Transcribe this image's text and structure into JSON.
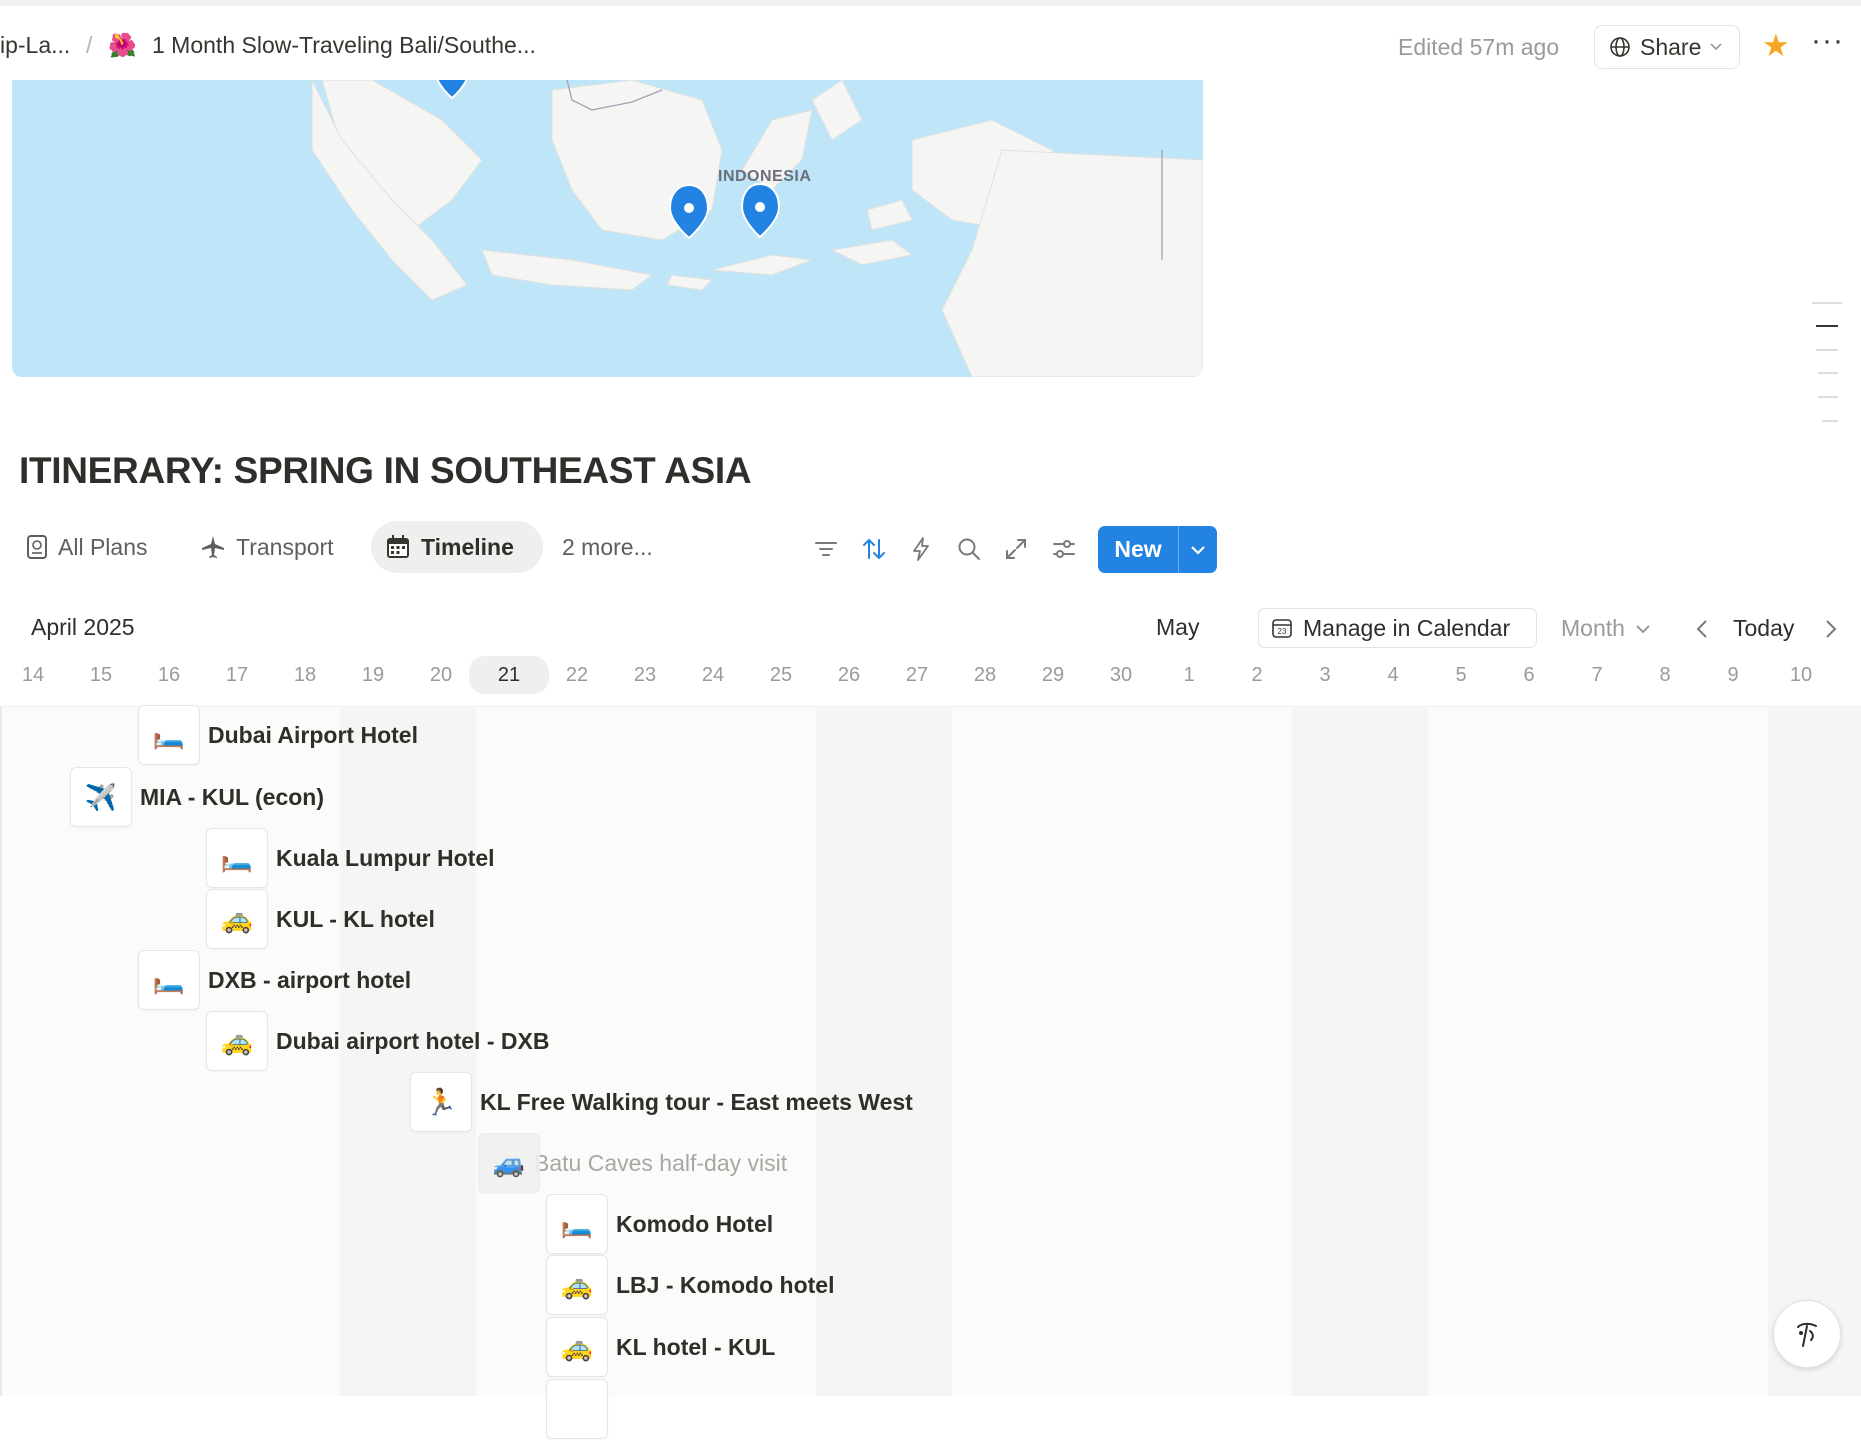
{
  "topbar": {
    "breadcrumb_parent": "ip-La...",
    "breadcrumb_separator": "/",
    "page_emoji": "🌺",
    "page_title": "1 Month Slow-Traveling Bali/Southe...",
    "edited": "Edited 57m ago",
    "share_label": "Share",
    "more_label": "···"
  },
  "map": {
    "country_label": "INDONESIA",
    "pin_color": "#2383e2",
    "water_color": "#bfe6f8",
    "land_color": "#f5f5f3"
  },
  "database": {
    "title": "ITINERARY: SPRING IN SOUTHEAST ASIA",
    "views": [
      {
        "label": "All Plans",
        "icon": "passport-icon"
      },
      {
        "label": "Transport",
        "icon": "airplane-icon"
      },
      {
        "label": "Timeline",
        "icon": "calendar-icon",
        "active": true
      }
    ],
    "more_views": "2 more...",
    "new_label": "New"
  },
  "timeline": {
    "month_left": "April 2025",
    "month_right": "May",
    "manage_label": "Manage in Calendar",
    "scale": "Month",
    "today_label": "Today",
    "days": [
      "14",
      "15",
      "16",
      "17",
      "18",
      "19",
      "20",
      "21",
      "22",
      "23",
      "24",
      "25",
      "26",
      "27",
      "28",
      "29",
      "30",
      "1",
      "2",
      "3",
      "4",
      "5",
      "6",
      "7",
      "8",
      "9",
      "10"
    ],
    "today_day": "21",
    "items": [
      {
        "icon": "🛏️",
        "label": "Dubai Airport Hotel"
      },
      {
        "icon": "✈️",
        "label": "MIA - KUL (econ)"
      },
      {
        "icon": "🛏️",
        "label": "Kuala Lumpur Hotel"
      },
      {
        "icon": "🚕",
        "label": "KUL - KL hotel"
      },
      {
        "icon": "🛏️",
        "label": "DXB - airport hotel"
      },
      {
        "icon": "🚕",
        "label": "Dubai airport hotel - DXB"
      },
      {
        "icon": "🏃",
        "label": "KL Free Walking tour - East meets West"
      },
      {
        "icon": "🚙",
        "label": "Batu Caves half-day visit"
      },
      {
        "icon": "🛏️",
        "label": "Komodo Hotel"
      },
      {
        "icon": "🚕",
        "label": "LBJ - Komodo hotel"
      },
      {
        "icon": "🚕",
        "label": "KL hotel - KUL"
      }
    ]
  },
  "colors": {
    "accent": "#2383e2",
    "star": "#f5a623",
    "text": "#37352f",
    "muted": "#9b9a97"
  }
}
